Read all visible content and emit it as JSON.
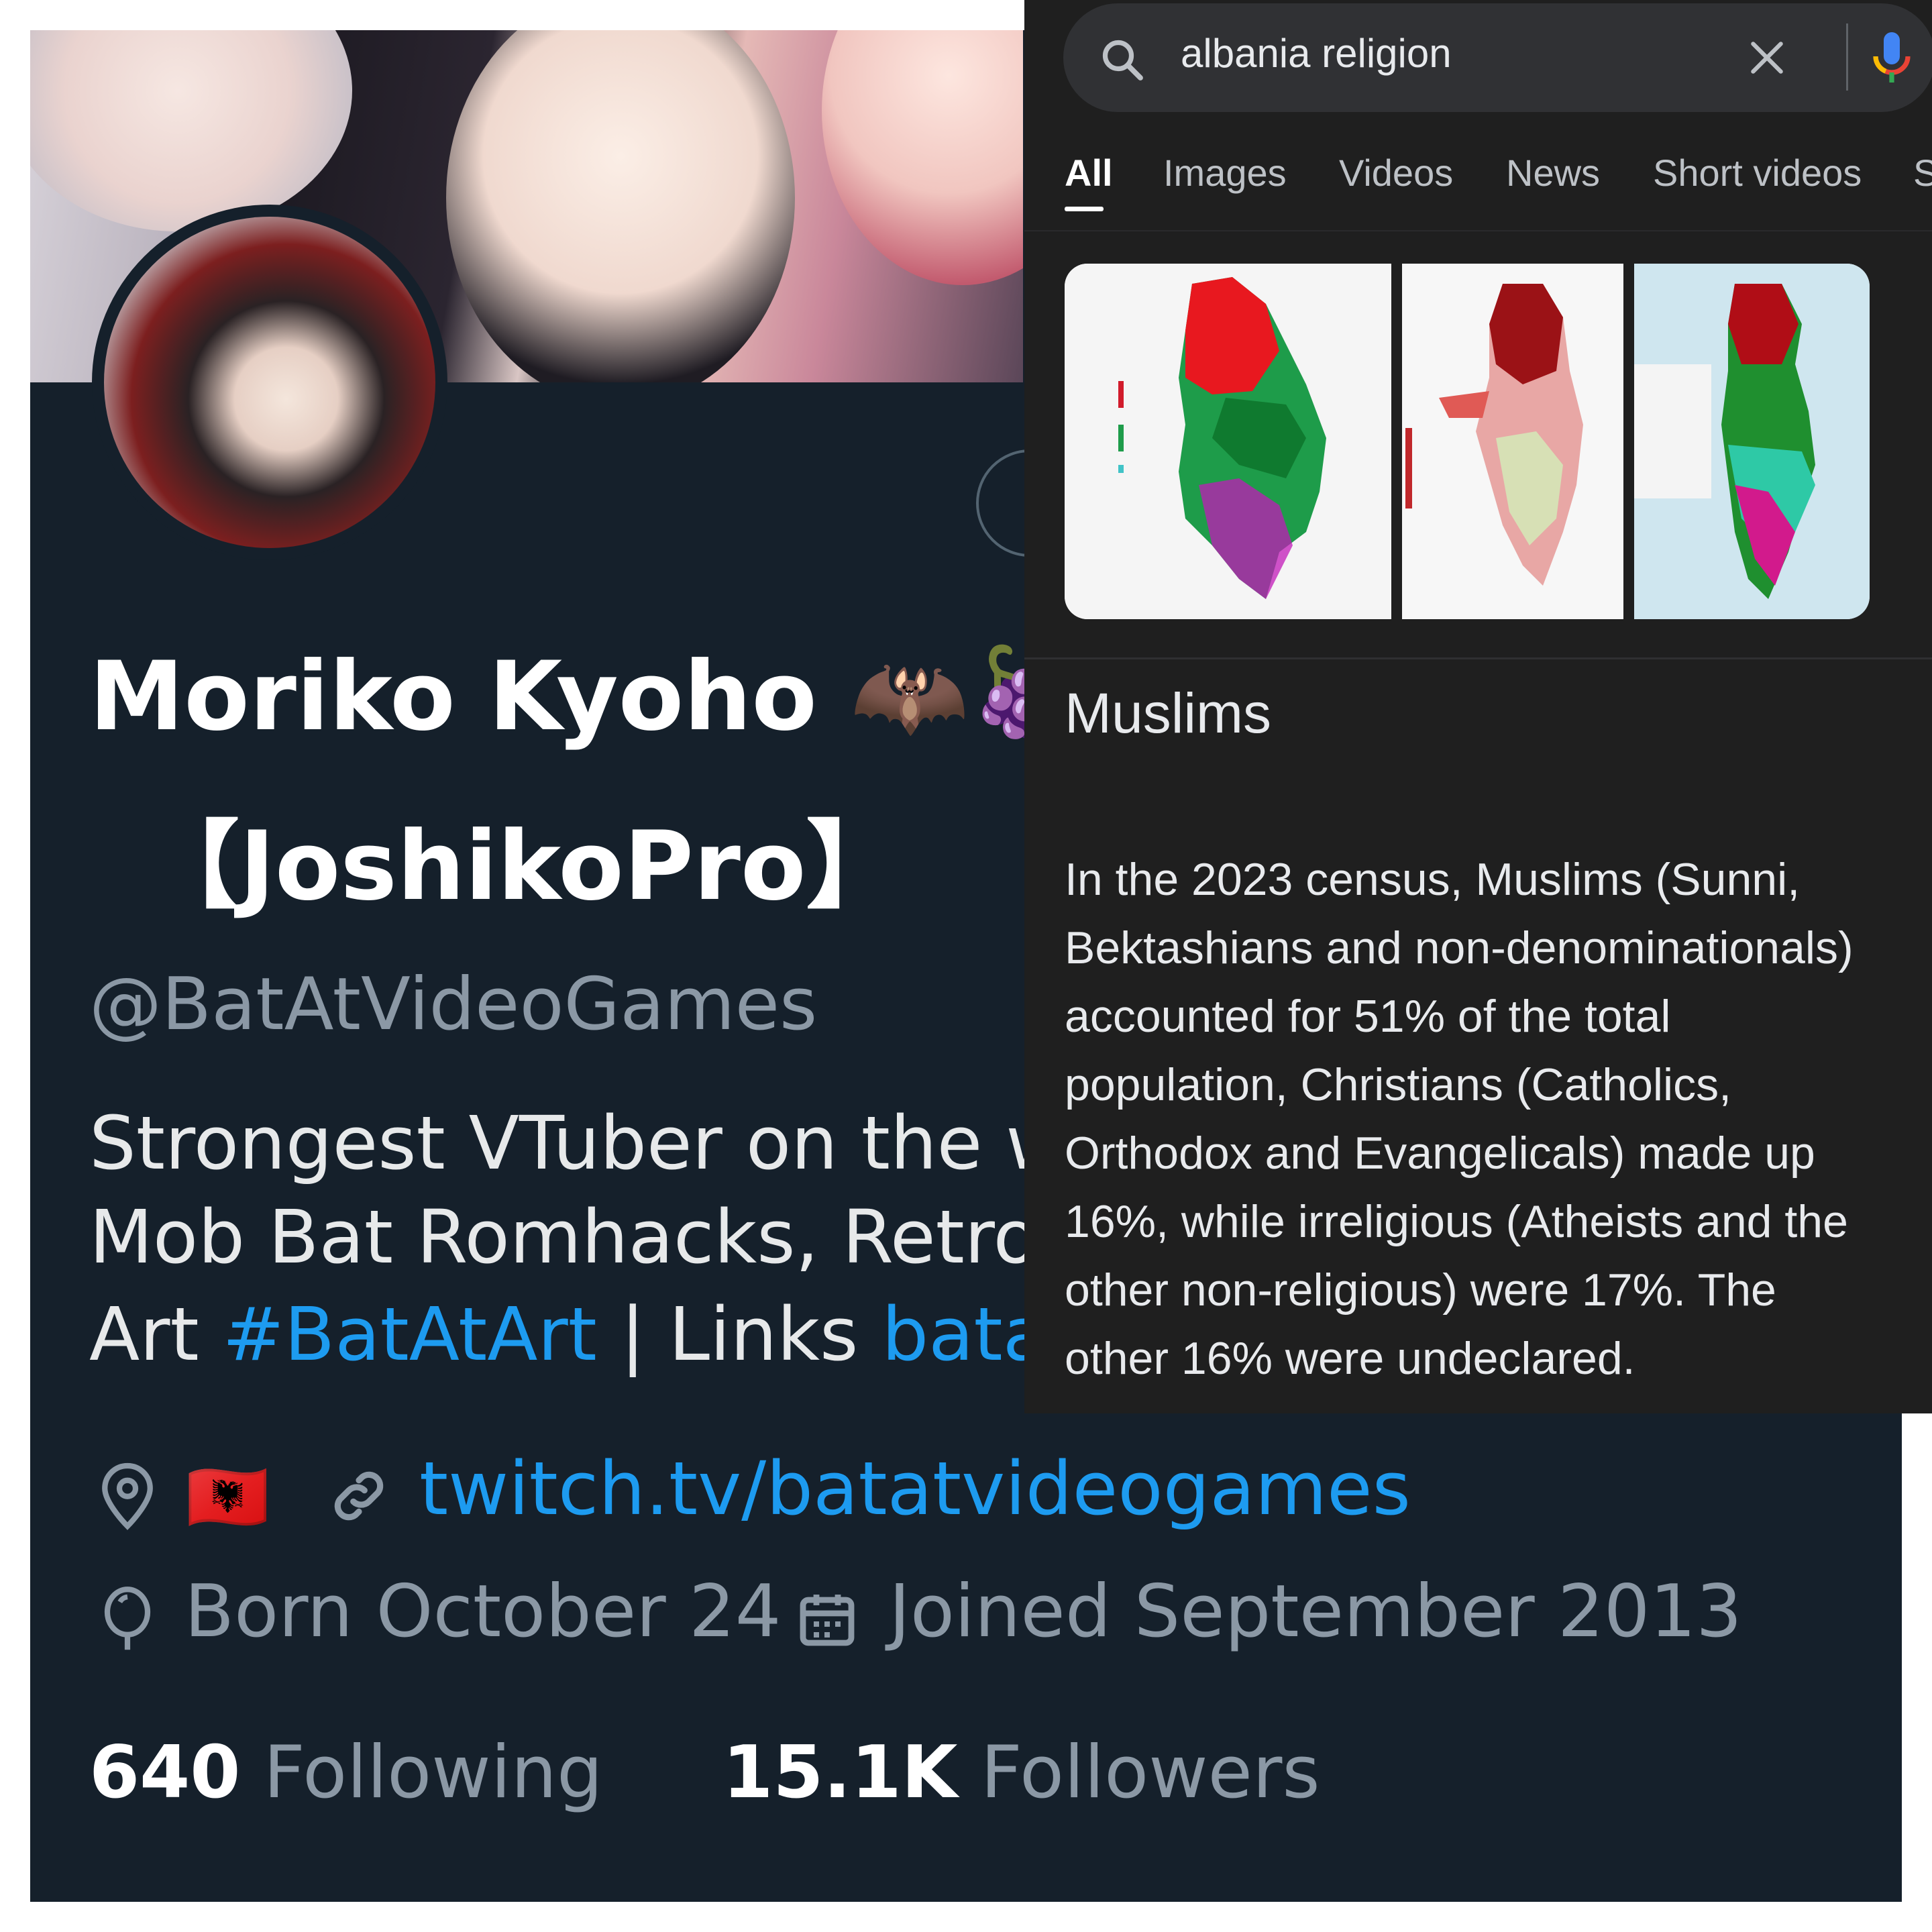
{
  "profile": {
    "display_name_line1": "Moriko Kyoho 🦇🍇",
    "display_name_line2": "【JoshikoPro】",
    "handle": "@BatAtVideoGames",
    "bio_line1": "Strongest VTuber on the we",
    "bio_line2": "Mob Bat  Romhacks, Retro, |",
    "bio_line3_prefix": "Art ",
    "bio_hashtag": "#BatAtArt",
    "bio_line3_middle": " | Links ",
    "bio_link": "batatv",
    "location_flag": "🇦🇱",
    "website": "twitch.tv/batatvideogames",
    "born": "Born October 24",
    "joined": "Joined September 2013",
    "following_count": "640",
    "following_label": "Following",
    "followers_count": "15.1K",
    "followers_label": "Followers",
    "colors": {
      "background": "#15202b",
      "link": "#1d9bf0",
      "muted": "#8b98a5"
    }
  },
  "google": {
    "search_query": "albania religion",
    "tabs": [
      {
        "label": "All",
        "active": true
      },
      {
        "label": "Images",
        "active": false
      },
      {
        "label": "Videos",
        "active": false
      },
      {
        "label": "News",
        "active": false
      },
      {
        "label": "Short videos",
        "active": false
      },
      {
        "label": "S",
        "active": false
      }
    ],
    "answer_title": "Muslims",
    "answer_lines": [
      "In the 2023 census, Muslims (Sunni,",
      "Bektashians and non-denominationals)",
      "accounted for 51% of the total",
      "population, Christians (Catholics,",
      "Orthodox and Evangelicals) made up",
      "16%, while irreligious (Atheists and the",
      "other non-religious) were 17%. The",
      "other 16% were undeclared."
    ],
    "colors": {
      "background": "#1f1f1f",
      "searchbox": "#303134",
      "text": "#e8eaed"
    }
  }
}
